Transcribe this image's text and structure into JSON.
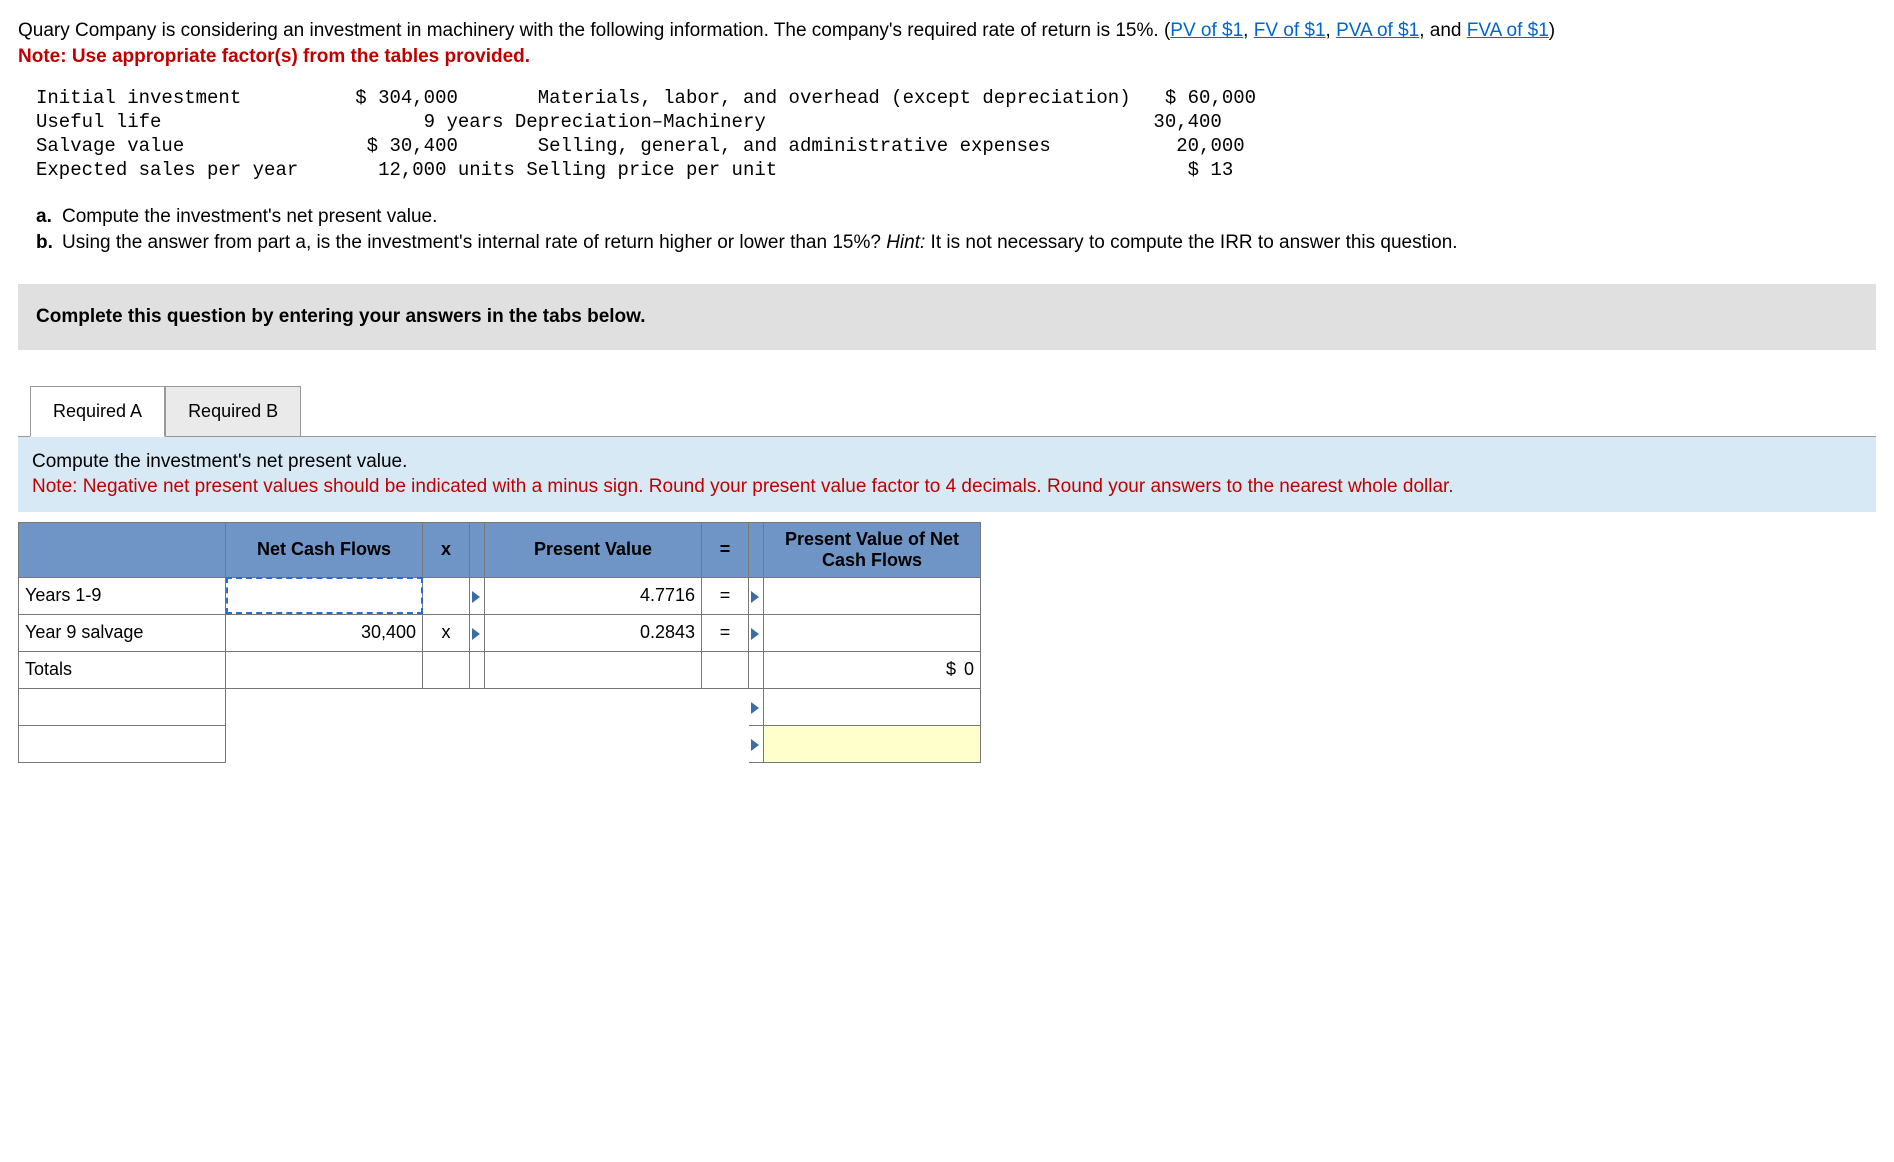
{
  "intro": {
    "text_before": "Quary Company is considering an investment in machinery with the following information. The company's required rate of return is 15%. (",
    "link1": "PV of $1",
    "comma1": ", ",
    "link2": "FV of $1",
    "comma2": ", ",
    "link3": "PVA of $1",
    "and": ", and ",
    "link4": "FVA of $1",
    "close": ")",
    "note": "Note: Use appropriate factor(s) from the tables provided."
  },
  "data_left": {
    "r1": {
      "label": "Initial investment",
      "value": "$ 304,000"
    },
    "r2": {
      "label": "Useful life",
      "value": "9 years"
    },
    "r3": {
      "label": "Salvage value",
      "value": "$ 30,400"
    },
    "r4": {
      "label": "Expected sales per year",
      "value": "12,000 units"
    }
  },
  "data_right": {
    "r1": {
      "label": "Materials, labor, and overhead (except depreciation)",
      "value": "$ 60,000"
    },
    "r2": {
      "label": "Depreciation–Machinery",
      "value": "30,400"
    },
    "r3": {
      "label": "Selling, general, and administrative expenses",
      "value": "20,000"
    },
    "r4": {
      "label": "Selling price per unit",
      "value": "$ 13"
    }
  },
  "questions": {
    "a_mark": "a.",
    "a_text": "Compute the investment's net present value.",
    "b_mark": "b.",
    "b_text_1": "Using the answer from part a, is the investment's internal rate of return higher or lower than 15%? ",
    "b_hint": "Hint:",
    "b_text_2": " It is not necessary to compute the IRR to answer this question."
  },
  "instruction": "Complete this question by entering your answers in the tabs below.",
  "tabs": {
    "a": "Required A",
    "b": "Required B"
  },
  "compute": {
    "line1": "Compute the investment's net present value.",
    "line2": "Note: Negative net present values should be indicated with a minus sign. Round your present value factor to 4 decimals. Round your answers to the nearest whole dollar."
  },
  "table": {
    "h_ncf": "Net Cash Flows",
    "h_x": "x",
    "h_pv": "Present Value",
    "h_eq": "=",
    "h_pvn": "Present Value of Net Cash Flows",
    "rows": {
      "r1": {
        "label": "Years 1-9",
        "ncf": "",
        "pv": "4.7716",
        "pvn": ""
      },
      "r2": {
        "label": "Year 9 salvage",
        "ncf": "30,400",
        "pv": "0.2843",
        "pvn": ""
      },
      "r3": {
        "label": "Totals",
        "pvn_sym": "$",
        "pvn_val": "0"
      }
    }
  }
}
